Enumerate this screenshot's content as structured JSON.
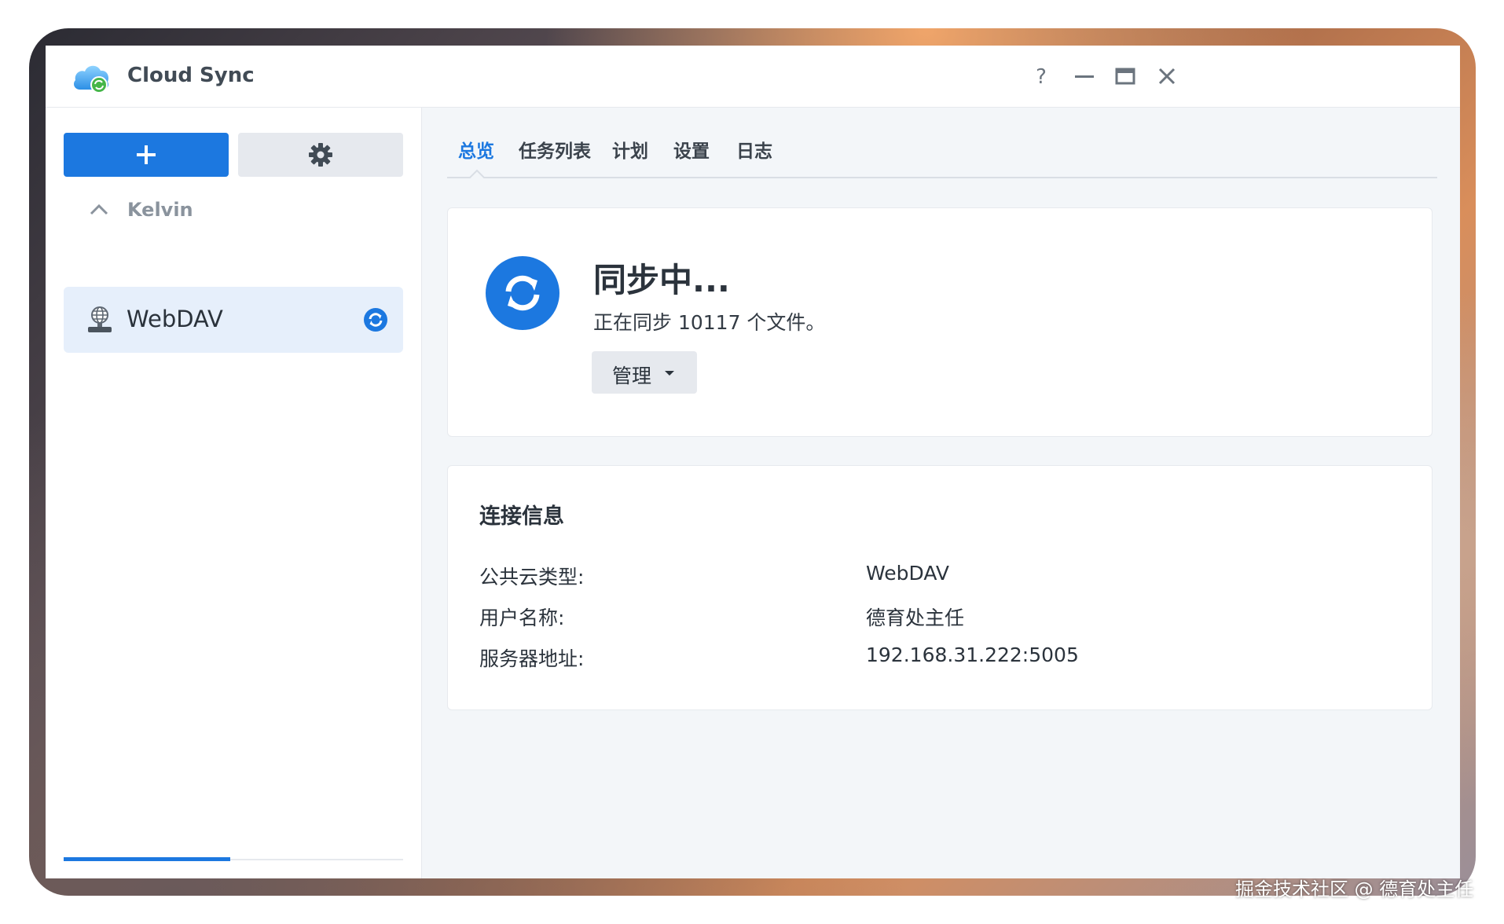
{
  "window": {
    "title": "Cloud Sync",
    "controls": [
      "help-icon",
      "minimize-icon",
      "maximize-icon",
      "close-icon"
    ]
  },
  "sidebar": {
    "add_icon": "plus-icon",
    "settings_icon": "gear-icon",
    "group": {
      "label": "Kelvin",
      "expanded": true
    },
    "tasks": [
      {
        "label": "WebDAV",
        "icon": "server-globe-icon",
        "status": "syncing"
      }
    ],
    "bottom_tabs": [
      {
        "icon": "user-icon",
        "active": true
      },
      {
        "icon": "cloud-icon",
        "active": false
      }
    ]
  },
  "tabs": [
    {
      "label": "总览",
      "active": true
    },
    {
      "label": "任务列表",
      "active": false
    },
    {
      "label": "计划",
      "active": false
    },
    {
      "label": "设置",
      "active": false
    },
    {
      "label": "日志",
      "active": false
    }
  ],
  "status": {
    "title": "同步中...",
    "description": "正在同步 10117 个文件。",
    "manage_label": "管理"
  },
  "connection": {
    "title": "连接信息",
    "rows": [
      {
        "key": "公共云类型:",
        "value": "WebDAV"
      },
      {
        "key": "用户名称:",
        "value": "德育处主任"
      },
      {
        "key": "服务器地址:",
        "value": "192.168.31.222:5005"
      }
    ]
  },
  "watermark": "掘金技术社区 @ 德育处主任",
  "colors": {
    "accent": "#1c78e0",
    "background": "#f3f6f9",
    "selected": "#e6effb"
  }
}
